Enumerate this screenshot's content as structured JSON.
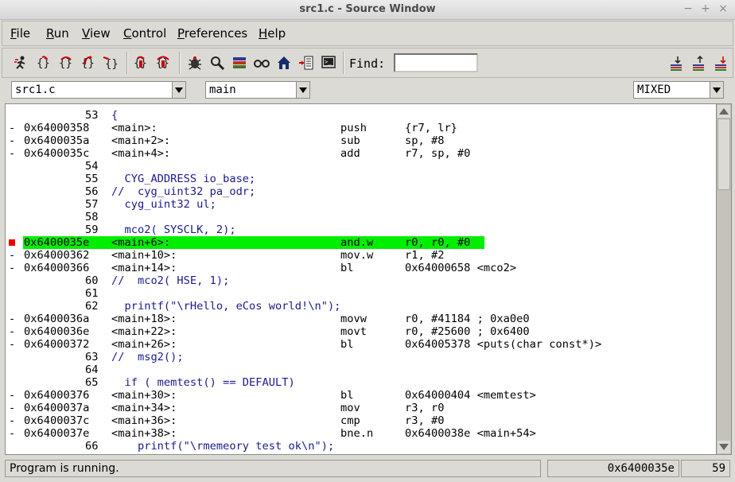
{
  "window": {
    "title": "src1.c - Source Window",
    "controls": [
      "−",
      "+",
      "×"
    ]
  },
  "menu": [
    {
      "label": "File",
      "u": "F",
      "rest": "ile"
    },
    {
      "label": "Run",
      "u": "R",
      "rest": "un"
    },
    {
      "label": "View",
      "u": "V",
      "rest": "iew"
    },
    {
      "label": "Control",
      "u": "C",
      "rest": "ontrol"
    },
    {
      "label": "Preferences",
      "u": "P",
      "rest": "references"
    },
    {
      "label": "Help",
      "u": "H",
      "rest": "elp"
    }
  ],
  "toolbar": {
    "find_label": "Find:",
    "find_value": "",
    "icons": [
      "run-icon",
      "step-icon",
      "next-icon",
      "finish-icon",
      "continue-icon",
      "stepi-icon",
      "nexti-icon",
      "breakpoints-icon",
      "watch-icon",
      "stack-icon",
      "locals-icon",
      "home-icon",
      "registers-icon",
      "console-icon",
      "go-down-icon",
      "go-up-icon",
      "go-bottom-icon"
    ]
  },
  "selectors": {
    "file": "src1.c",
    "function": "main",
    "mode": "MIXED"
  },
  "listing": [
    {
      "type": "src",
      "line": "53",
      "text": "{"
    },
    {
      "type": "asm",
      "mark": "-",
      "addr": "0x64000358",
      "sym": "<main>:",
      "op": "push",
      "args": "{r7, lr}"
    },
    {
      "type": "asm",
      "mark": "-",
      "addr": "0x6400035a",
      "sym": "<main+2>:",
      "op": "sub",
      "args": "sp, #8"
    },
    {
      "type": "asm",
      "mark": "-",
      "addr": "0x6400035c",
      "sym": "<main+4>:",
      "op": "add",
      "args": "r7, sp, #0"
    },
    {
      "type": "src",
      "line": "54",
      "text": ""
    },
    {
      "type": "src",
      "line": "55",
      "text": "  CYG_ADDRESS io_base;"
    },
    {
      "type": "src",
      "line": "56",
      "text": "//  cyg_uint32 pa_odr;"
    },
    {
      "type": "src",
      "line": "57",
      "text": "  cyg_uint32 ul;"
    },
    {
      "type": "src",
      "line": "58",
      "text": ""
    },
    {
      "type": "src",
      "line": "59",
      "text": "  mco2( SYSCLK, 2);"
    },
    {
      "type": "asm",
      "mark": "bp",
      "highlight": true,
      "addr": "0x6400035e",
      "sym": "<main+6>:",
      "op": "and.w",
      "args": "r0, r0, #0"
    },
    {
      "type": "asm",
      "mark": "-",
      "addr": "0x64000362",
      "sym": "<main+10>:",
      "op": "mov.w",
      "args": "r1, #2"
    },
    {
      "type": "asm",
      "mark": "-",
      "addr": "0x64000366",
      "sym": "<main+14>:",
      "op": "bl",
      "args": "0x64000658 <mco2>"
    },
    {
      "type": "src",
      "line": "60",
      "text": "//  mco2( HSE, 1);"
    },
    {
      "type": "src",
      "line": "61",
      "text": ""
    },
    {
      "type": "src",
      "line": "62",
      "text": "  printf(\"\\rHello, eCos world!\\n\");"
    },
    {
      "type": "asm",
      "mark": "-",
      "addr": "0x6400036a",
      "sym": "<main+18>:",
      "op": "movw",
      "args": "r0, #41184 ; 0xa0e0"
    },
    {
      "type": "asm",
      "mark": "-",
      "addr": "0x6400036e",
      "sym": "<main+22>:",
      "op": "movt",
      "args": "r0, #25600 ; 0x6400"
    },
    {
      "type": "asm",
      "mark": "-",
      "addr": "0x64000372",
      "sym": "<main+26>:",
      "op": "bl",
      "args": "0x64005378 <puts(char const*)>"
    },
    {
      "type": "src",
      "line": "63",
      "text": "//  msg2();"
    },
    {
      "type": "src",
      "line": "64",
      "text": ""
    },
    {
      "type": "src",
      "line": "65",
      "text": "  if ( memtest() == DEFAULT)"
    },
    {
      "type": "asm",
      "mark": "-",
      "addr": "0x64000376",
      "sym": "<main+30>:",
      "op": "bl",
      "args": "0x64000404 <memtest>"
    },
    {
      "type": "asm",
      "mark": "-",
      "addr": "0x6400037a",
      "sym": "<main+34>:",
      "op": "mov",
      "args": "r3, r0"
    },
    {
      "type": "asm",
      "mark": "-",
      "addr": "0x6400037c",
      "sym": "<main+36>:",
      "op": "cmp",
      "args": "r3, #0"
    },
    {
      "type": "asm",
      "mark": "-",
      "addr": "0x6400037e",
      "sym": "<main+38>:",
      "op": "bne.n",
      "args": "0x6400038e <main+54>"
    },
    {
      "type": "src",
      "line": "66",
      "text": "    printf(\"\\rmemeory test ok\\n\");"
    }
  ],
  "status": {
    "message": "Program is running.",
    "pc": "0x6400035e",
    "line": "59"
  },
  "colors": {
    "highlight": "#00ee00",
    "breakpoint": "#ee0000",
    "source_text": "#1a1a8c"
  }
}
